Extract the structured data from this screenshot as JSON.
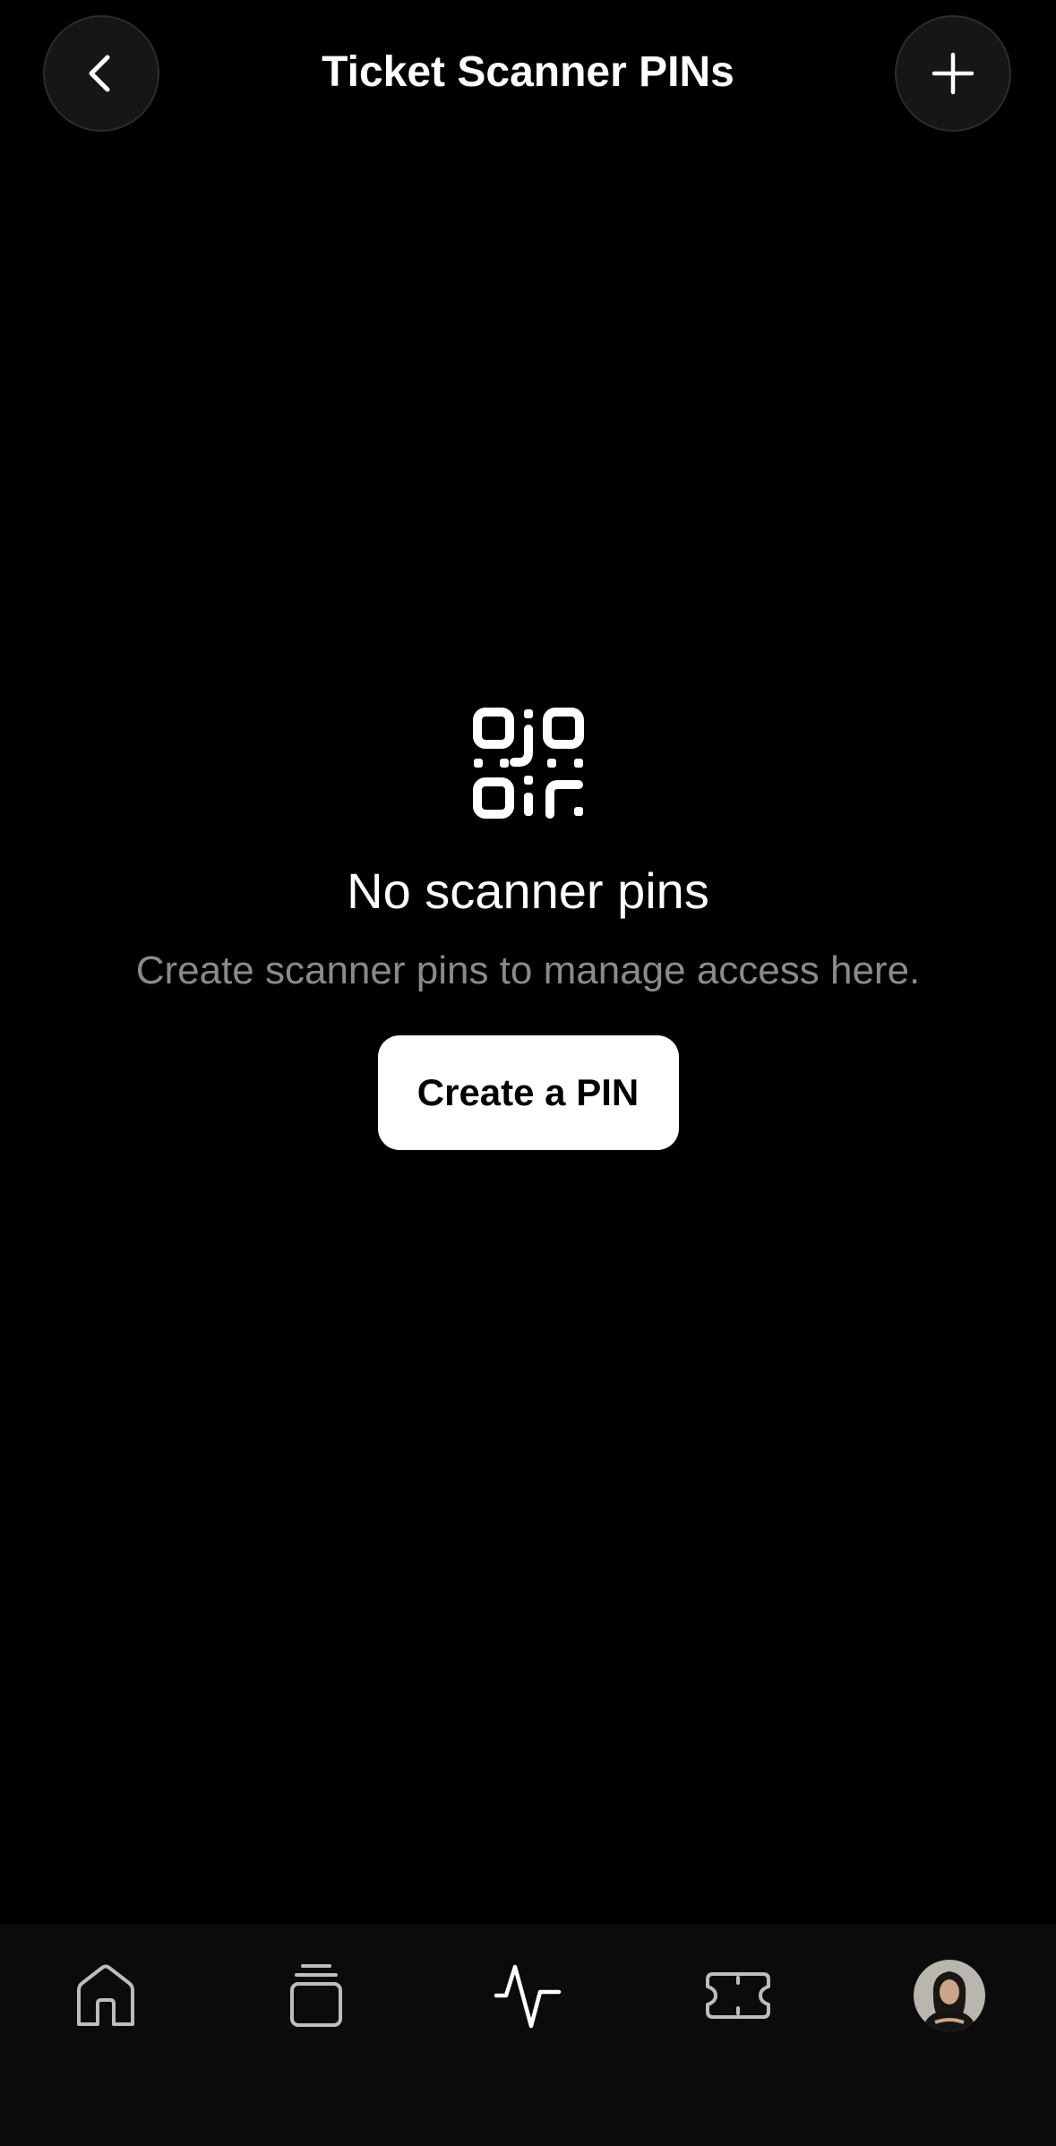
{
  "header": {
    "title": "Ticket Scanner PINs",
    "back_icon": "chevron-left-icon",
    "add_icon": "plus-icon"
  },
  "empty_state": {
    "icon": "qr-code-icon",
    "title": "No scanner pins",
    "subtitle": "Create scanner pins to manage access here.",
    "button_label": "Create a PIN"
  },
  "tabbar": {
    "items": [
      {
        "icon": "home-icon"
      },
      {
        "icon": "stack-icon"
      },
      {
        "icon": "activity-icon"
      },
      {
        "icon": "ticket-icon"
      },
      {
        "icon": "avatar"
      }
    ]
  },
  "colors": {
    "background": "#000000",
    "tabbar": "#0b0b0b",
    "button_bg": "#161616",
    "primary_text": "#ffffff",
    "secondary_text": "#8a8a8a"
  }
}
